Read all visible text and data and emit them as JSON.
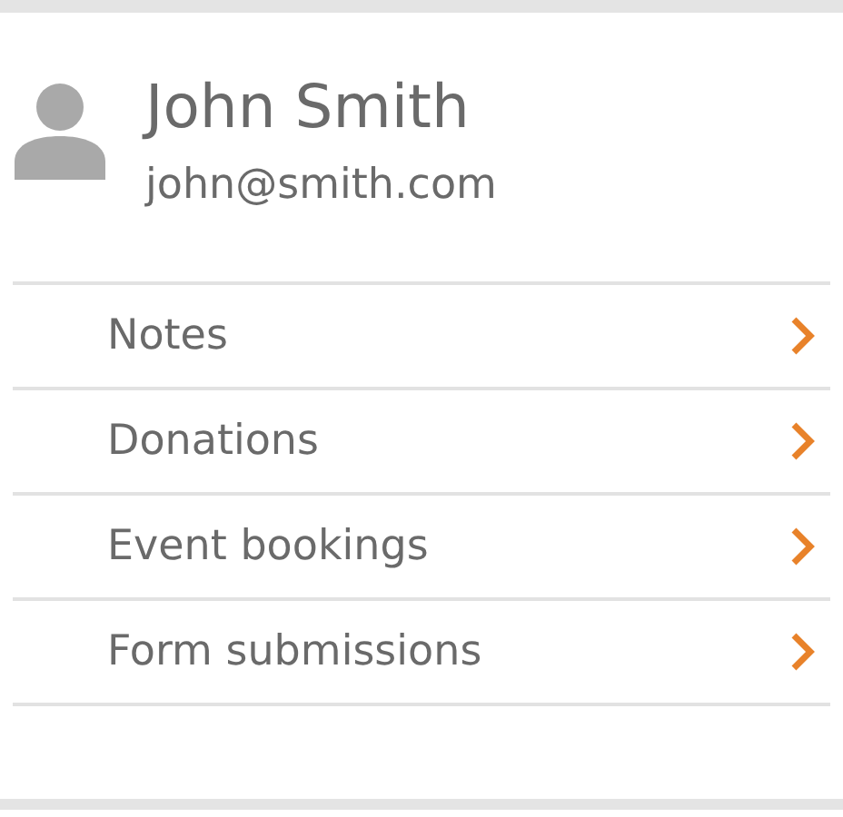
{
  "contact": {
    "name": "John Smith",
    "email": "john@smith.com"
  },
  "links": [
    {
      "label": "Notes"
    },
    {
      "label": "Donations"
    },
    {
      "label": "Event bookings"
    },
    {
      "label": "Form submissions"
    }
  ]
}
